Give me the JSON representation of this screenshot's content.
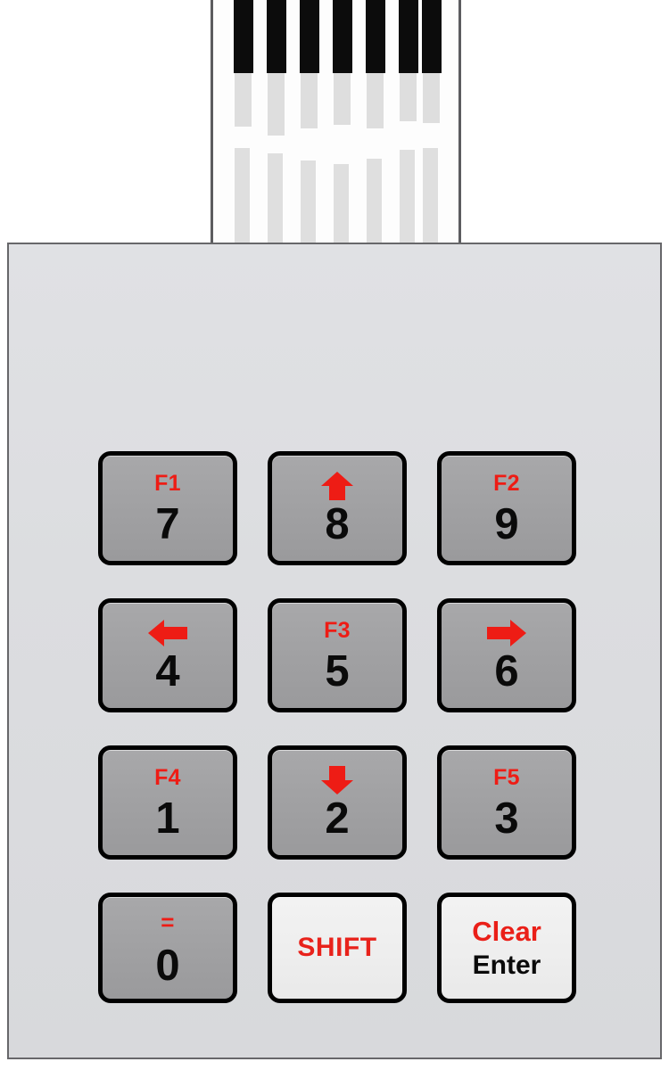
{
  "device": {
    "name": "3x4 Matrix Membrane Keypad",
    "panel_color": "#dcdde0",
    "key_gray": "#a0a0a2",
    "key_light": "#eeeeee",
    "legend_red": "#ee1c15",
    "legend_black": "#0a0a0a",
    "border_color": "#000000"
  },
  "ribbon": {
    "name": "ribbon-cable-tail",
    "contact_count": 7,
    "contact_color": "#0c0c0c",
    "trace_color": "#dedede",
    "edge_color": "#5c5c5f"
  },
  "keys": [
    {
      "id": "key-7",
      "top_label": "F1",
      "top_type": "text",
      "main_label": "7",
      "style": "gray"
    },
    {
      "id": "key-8",
      "top_label": "up",
      "top_type": "arrow",
      "main_label": "8",
      "style": "gray"
    },
    {
      "id": "key-9",
      "top_label": "F2",
      "top_type": "text",
      "main_label": "9",
      "style": "gray"
    },
    {
      "id": "key-4",
      "top_label": "left",
      "top_type": "arrow",
      "main_label": "4",
      "style": "gray"
    },
    {
      "id": "key-5",
      "top_label": "F3",
      "top_type": "text",
      "main_label": "5",
      "style": "gray"
    },
    {
      "id": "key-6",
      "top_label": "right",
      "top_type": "arrow",
      "main_label": "6",
      "style": "gray"
    },
    {
      "id": "key-1",
      "top_label": "F4",
      "top_type": "text",
      "main_label": "1",
      "style": "gray"
    },
    {
      "id": "key-2",
      "top_label": "down",
      "top_type": "arrow",
      "main_label": "2",
      "style": "gray"
    },
    {
      "id": "key-3",
      "top_label": "F5",
      "top_type": "text",
      "main_label": "3",
      "style": "gray"
    },
    {
      "id": "key-0",
      "top_label": "=",
      "top_type": "text",
      "main_label": "0",
      "style": "gray"
    },
    {
      "id": "key-shift",
      "top_label": "SHIFT",
      "top_type": "solo",
      "main_label": "",
      "style": "light"
    },
    {
      "id": "key-clear-enter",
      "top_label": "Clear",
      "top_type": "text",
      "main_label": "Enter",
      "style": "light"
    }
  ],
  "labels": {
    "f1": "F1",
    "f2": "F2",
    "f3": "F3",
    "f4": "F4",
    "f5": "F5",
    "equals": "=",
    "shift": "SHIFT",
    "clear": "Clear",
    "enter": "Enter",
    "n0": "0",
    "n1": "1",
    "n2": "2",
    "n3": "3",
    "n4": "4",
    "n5": "5",
    "n6": "6",
    "n7": "7",
    "n8": "8",
    "n9": "9"
  }
}
